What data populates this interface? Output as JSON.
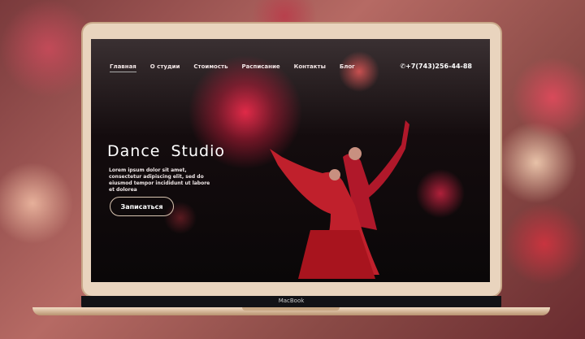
{
  "laptop_label": "MacBook",
  "nav": {
    "items": [
      "Главная",
      "О студии",
      "Стоимость",
      "Расписание",
      "Контакты",
      "Блог"
    ],
    "active": "Главная"
  },
  "phone": "+7(743)256-44-88",
  "hero": {
    "title": "Dance Studio",
    "text": "Lorem ipsum dolor sit amet, consectetur adipiscing  elit, sed do eiusmod tempor incididunt ut labore et dolorea",
    "button": "Записаться"
  },
  "colors": {
    "accent": "#e02a48",
    "bezel": "#e9d4be"
  }
}
